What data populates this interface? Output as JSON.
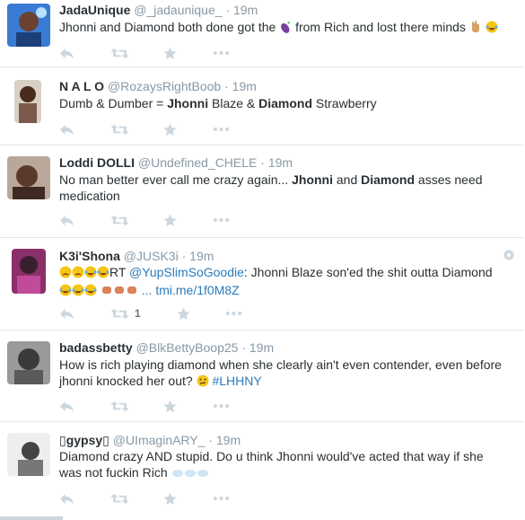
{
  "tweets": [
    {
      "name": "JadaUnique",
      "handle": "@_jadaunique_",
      "time": "19m",
      "text_1": "Jhonni and Diamond both done got the",
      "text_2": "from Rich and lost there minds"
    },
    {
      "name": "N A L O",
      "handle": "@RozaysRightBoob",
      "time": "19m",
      "text_1": "Dumb & Dumber = ",
      "bold_1": "Jhonni",
      "text_2": " Blaze & ",
      "bold_2": "Diamond",
      "text_3": " Strawberry"
    },
    {
      "name": "Loddi DOLLI",
      "handle": "@Undefined_CHELE",
      "time": "19m",
      "text_1": "No man better ever call me crazy again... ",
      "bold_1": "Jhonni",
      "text_2": " and ",
      "bold_2": "Diamond",
      "text_3": " asses need",
      "line_2": "medication"
    },
    {
      "name": "K3i'Shona",
      "handle": "@JUSK3i",
      "time": "19m",
      "text_1": "RT ",
      "mention": "@YupSlimSoGoodie",
      "text_2": ": Jhonni Blaze son'ed the shit outta Diamond",
      "link": "... tmi.me/1f0M8Z",
      "retweet_count": "1"
    },
    {
      "name": "badassbetty",
      "handle": "@BlkBettyBoop25",
      "time": "19m",
      "text_1": "How is rich playing diamond when she clearly ain't even contender, even before",
      "text_2": "jhonni knocked her out?",
      "hashtag": "#LHHNY"
    },
    {
      "name": "▯gypsy▯",
      "handle": "@UImaginARY_",
      "time": "19m",
      "text_1": "Diamond crazy AND stupid. Do u think Jhonni would've acted that way if she",
      "text_2": "was not fuckin Rich"
    }
  ],
  "separator": "·",
  "icons": {
    "reply": "reply-icon",
    "retweet": "retweet-icon",
    "favorite": "star-icon",
    "more": "more-icon",
    "gear": "gear-icon"
  },
  "colors": {
    "name": "#292f33",
    "meta": "#8899a6",
    "link": "#2b7bb9",
    "action": "#ccd6dd",
    "border": "#e1e8ed"
  }
}
